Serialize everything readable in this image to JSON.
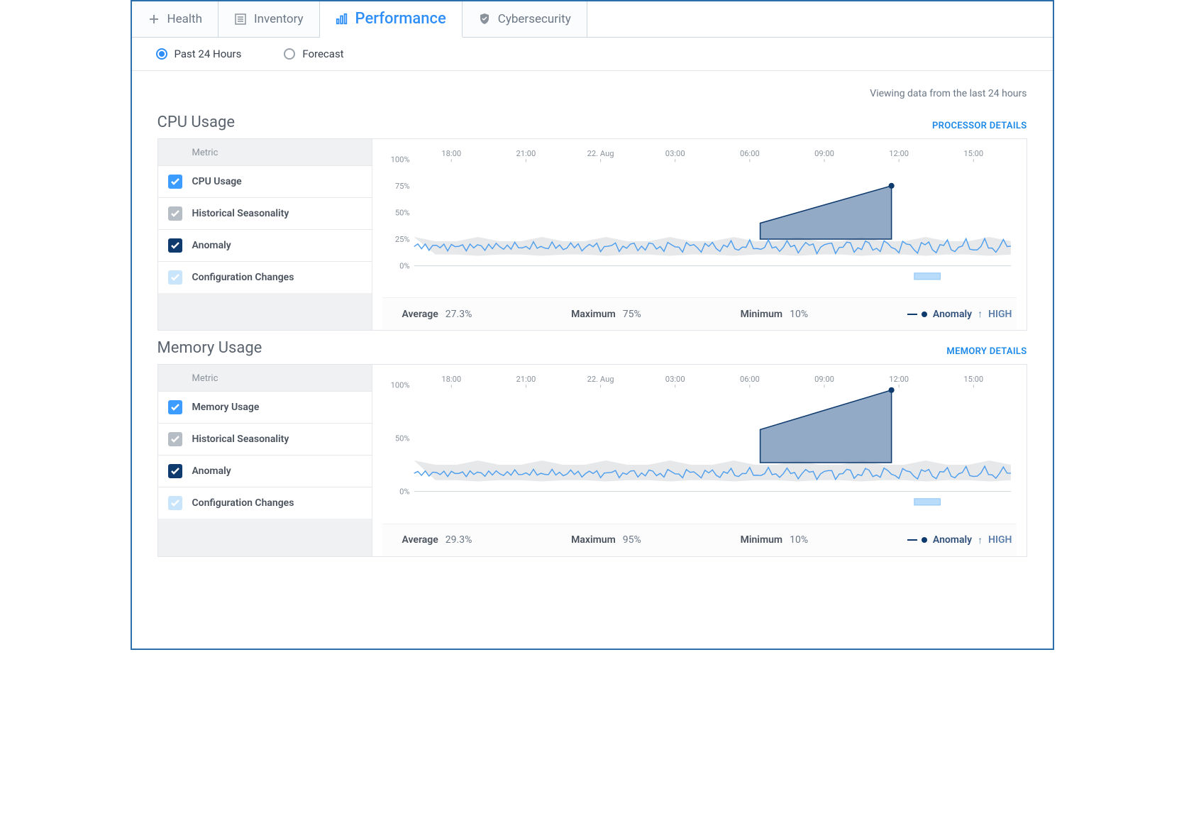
{
  "tabs": [
    {
      "id": "health",
      "label": "Health",
      "icon": "plus"
    },
    {
      "id": "inventory",
      "label": "Inventory",
      "icon": "list"
    },
    {
      "id": "performance",
      "label": "Performance",
      "icon": "bars",
      "active": true
    },
    {
      "id": "cybersecurity",
      "label": "Cybersecurity",
      "icon": "shield"
    }
  ],
  "range": {
    "options": [
      {
        "id": "past24",
        "label": "Past 24 Hours",
        "checked": true
      },
      {
        "id": "forecast",
        "label": "Forecast",
        "checked": false
      }
    ]
  },
  "info_line": "Viewing data from the last 24 hours",
  "legend_header": "Metric",
  "legend_items": [
    {
      "id": "primary",
      "color": "#3c9cff",
      "checked": true
    },
    {
      "id": "seasonality",
      "label": "Historical Seasonality",
      "color": "#b7bdc4",
      "checked": true
    },
    {
      "id": "anomaly",
      "label": "Anomaly",
      "color": "#0e3a6e",
      "checked": true
    },
    {
      "id": "config",
      "label": "Configuration Changes",
      "color": "#c9e5fb",
      "checked": true
    }
  ],
  "x_ticks": [
    "18:00",
    "21:00",
    "22. Aug",
    "03:00",
    "06:00",
    "09:00",
    "12:00",
    "15:00"
  ],
  "stat_labels": {
    "avg": "Average",
    "max": "Maximum",
    "min": "Minimum",
    "anomaly": "Anomaly",
    "high": "HIGH"
  },
  "cards": [
    {
      "id": "cpu",
      "title": "CPU Usage",
      "link": "PROCESSOR DETAILS",
      "primary_label": "CPU Usage",
      "y_ticks": [
        "100%",
        "75%",
        "50%",
        "25%",
        "0%"
      ],
      "stats": {
        "avg": "27.3%",
        "max": "75%",
        "min": "10%",
        "anomaly_dir": "↑",
        "anomaly_level": "HIGH"
      }
    },
    {
      "id": "memory",
      "title": "Memory Usage",
      "link": "MEMORY DETAILS",
      "primary_label": "Memory Usage",
      "y_ticks": [
        "100%",
        "50%",
        "0%"
      ],
      "stats": {
        "avg": "29.3%",
        "max": "95%",
        "min": "10%",
        "anomaly_dir": "↑",
        "anomaly_level": "HIGH"
      }
    }
  ],
  "chart_data": [
    {
      "id": "cpu",
      "type": "line",
      "title": "CPU Usage",
      "xlabel": "",
      "ylabel": "",
      "ylim": [
        0,
        100
      ],
      "x_range": [
        "15:00 prev",
        "15:00"
      ],
      "series": [
        {
          "name": "CPU Usage",
          "approx_noisy_band": [
            12,
            24
          ],
          "anomaly_segment": {
            "start_x_frac": 0.58,
            "end_x_frac": 0.8,
            "start_val": 40,
            "peak_val": 75
          }
        },
        {
          "name": "Historical Seasonality",
          "band": [
            10,
            25
          ]
        },
        {
          "name": "Anomaly",
          "peak": 75
        },
        {
          "name": "Configuration Changes",
          "marker_x_frac": 0.86
        }
      ],
      "summary": {
        "average": 27.3,
        "maximum": 75,
        "minimum": 10,
        "anomaly": "HIGH"
      }
    },
    {
      "id": "memory",
      "type": "line",
      "title": "Memory Usage",
      "xlabel": "",
      "ylabel": "",
      "ylim": [
        0,
        100
      ],
      "x_range": [
        "15:00 prev",
        "15:00"
      ],
      "series": [
        {
          "name": "Memory Usage",
          "approx_noisy_band": [
            12,
            22
          ],
          "anomaly_segment": {
            "start_x_frac": 0.58,
            "end_x_frac": 0.8,
            "start_val": 58,
            "peak_val": 95
          }
        },
        {
          "name": "Historical Seasonality",
          "band": [
            10,
            27
          ]
        },
        {
          "name": "Anomaly",
          "peak": 95
        },
        {
          "name": "Configuration Changes",
          "marker_x_frac": 0.86
        }
      ],
      "summary": {
        "average": 29.3,
        "maximum": 95,
        "minimum": 10,
        "anomaly": "HIGH"
      }
    }
  ]
}
